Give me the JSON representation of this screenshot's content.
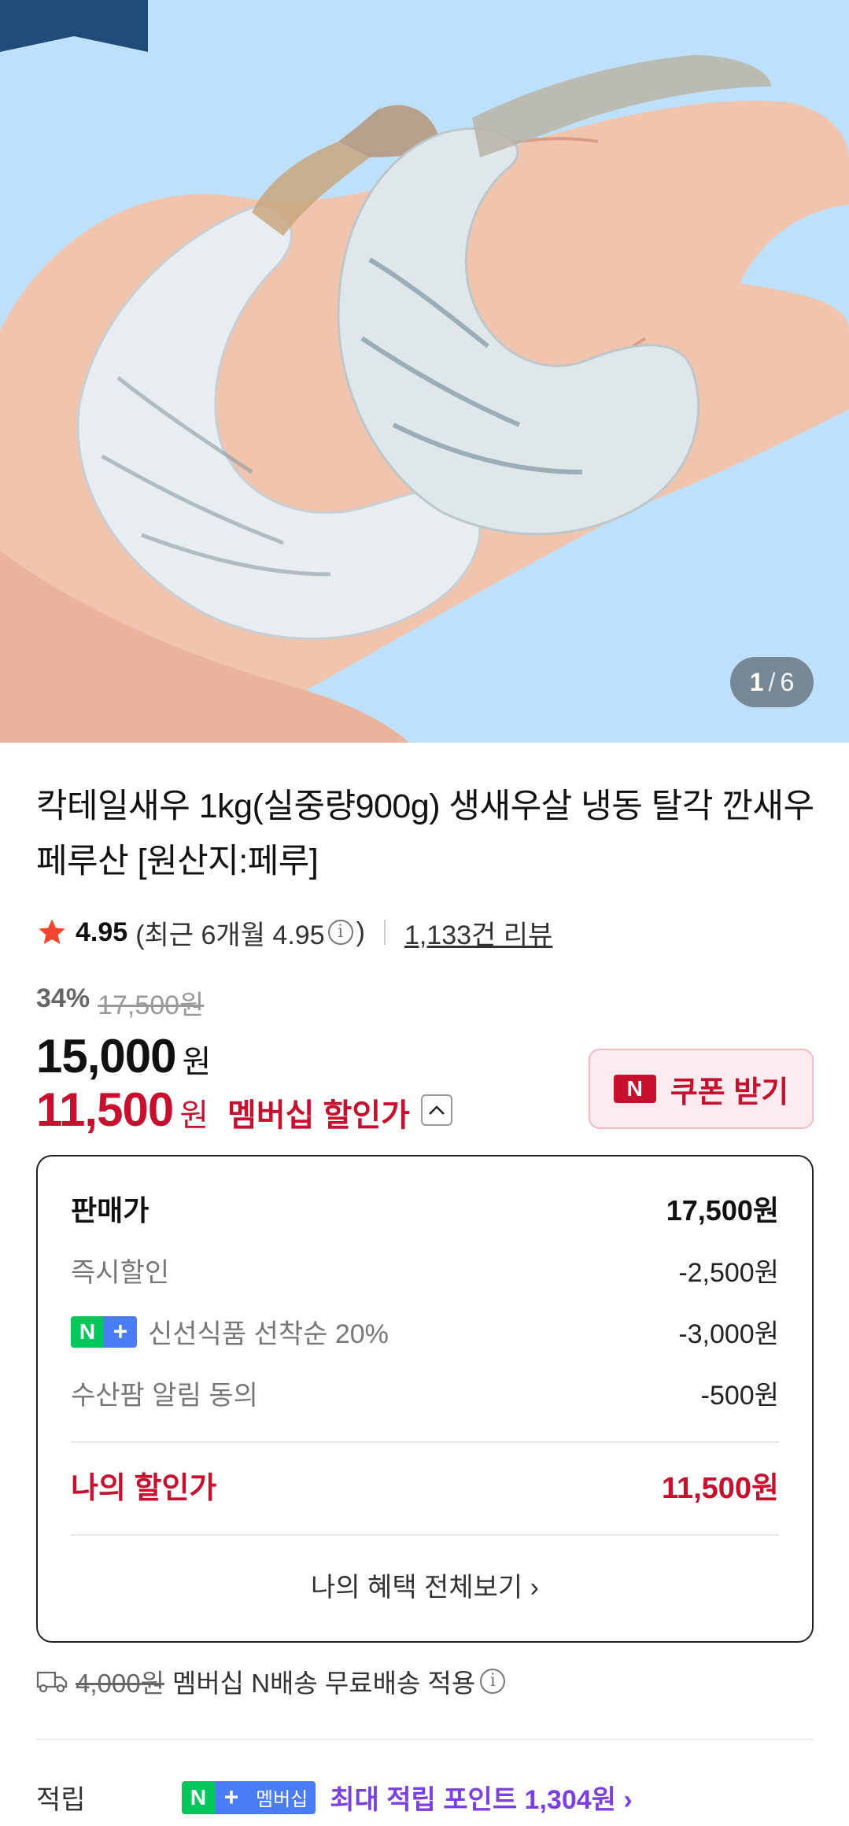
{
  "gallery": {
    "current": "1",
    "total": "6",
    "separator": "/"
  },
  "product": {
    "title": "칵테일새우 1kg(실중량900g) 생새우살 냉동 탈각 깐새우 페루산 [원산지:페루]"
  },
  "rating": {
    "score": "4.95",
    "recent_prefix": "(최근 6개월 4.95",
    "recent_suffix": ")",
    "reviews": "1,133건 리뷰"
  },
  "price": {
    "discount_pct": "34%",
    "original": "17,500원",
    "sale": "15,000",
    "currency": "원",
    "member_price": "11,500",
    "member_label": "멤버십 할인가",
    "coupon_label": "쿠폰 받기",
    "coupon_logo": "N"
  },
  "breakdown": {
    "head_label": "판매가",
    "head_value": "17,500원",
    "rows": [
      {
        "label": "즉시할인",
        "value": "-2,500원"
      },
      {
        "label": "신선식품 선착순 20%",
        "value": "-3,000원"
      },
      {
        "label": "수산팜 알림 동의",
        "value": "-500원"
      }
    ],
    "mine_label": "나의 할인가",
    "mine_value": "11,500원",
    "view_all": "나의 혜택 전체보기 ›"
  },
  "badges": {
    "n": "N",
    "plus": "+",
    "membership": "멤버십"
  },
  "shipping": {
    "original_fee": "4,000원",
    "text": "멤버십 N배송 무료배송 적용"
  },
  "points": {
    "label": "적립",
    "text": "최대 적립 포인트 1,304원 ›"
  },
  "colors": {
    "accent_red": "#c8102e",
    "naver_green": "#03c75a",
    "plus_blue": "#4a7cf6",
    "points_purple": "#7b3fe4",
    "hero_bg": "#bfe0fb"
  }
}
